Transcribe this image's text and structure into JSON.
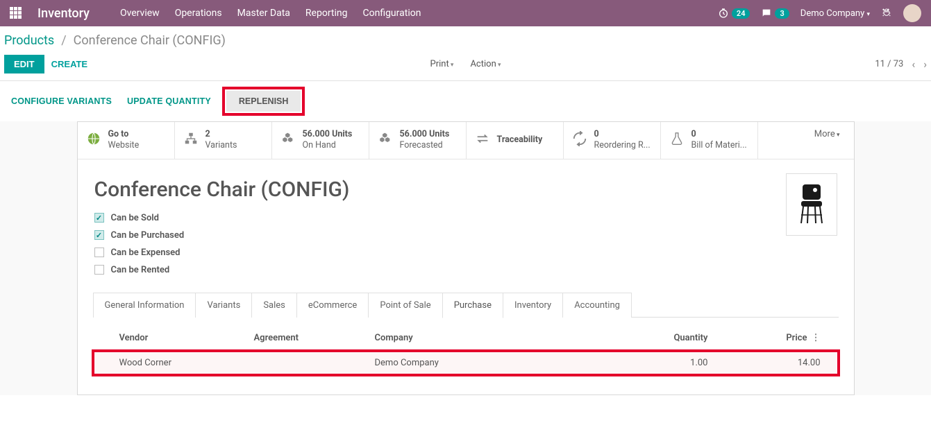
{
  "navbar": {
    "brand": "Inventory",
    "links": [
      "Overview",
      "Operations",
      "Master Data",
      "Reporting",
      "Configuration"
    ],
    "timer_badge": "24",
    "chat_badge": "3",
    "company": "Demo Company"
  },
  "breadcrumb": {
    "root": "Products",
    "current": "Conference Chair (CONFIG)"
  },
  "controls": {
    "edit": "EDIT",
    "create": "CREATE",
    "print": "Print",
    "action": "Action",
    "pager": "11 / 73"
  },
  "action_buttons": {
    "configure": "CONFIGURE VARIANTS",
    "update_qty": "UPDATE QUANTITY",
    "replenish": "REPLENISH"
  },
  "stats": {
    "website_top": "Go to",
    "website_bot": "Website",
    "variants_top": "2",
    "variants_bot": "Variants",
    "onhand_top": "56.000 Units",
    "onhand_bot": "On Hand",
    "forecast_top": "56.000 Units",
    "forecast_bot": "Forecasted",
    "trace": "Traceability",
    "reorder_top": "0",
    "reorder_bot": "Reordering R...",
    "bom_top": "0",
    "bom_bot": "Bill of Materi...",
    "more": "More"
  },
  "product": {
    "title": "Conference Chair (CONFIG)",
    "checks": {
      "sold": "Can be Sold",
      "purchased": "Can be Purchased",
      "expensed": "Can be Expensed",
      "rented": "Can be Rented"
    }
  },
  "tabs": [
    "General Information",
    "Variants",
    "Sales",
    "eCommerce",
    "Point of Sale",
    "Purchase",
    "Inventory",
    "Accounting"
  ],
  "active_tab": "Purchase",
  "table": {
    "headers": {
      "vendor": "Vendor",
      "agreement": "Agreement",
      "company": "Company",
      "quantity": "Quantity",
      "price": "Price"
    },
    "row": {
      "vendor": "Wood Corner",
      "agreement": "",
      "company": "Demo Company",
      "quantity": "1.00",
      "price": "14.00"
    }
  }
}
